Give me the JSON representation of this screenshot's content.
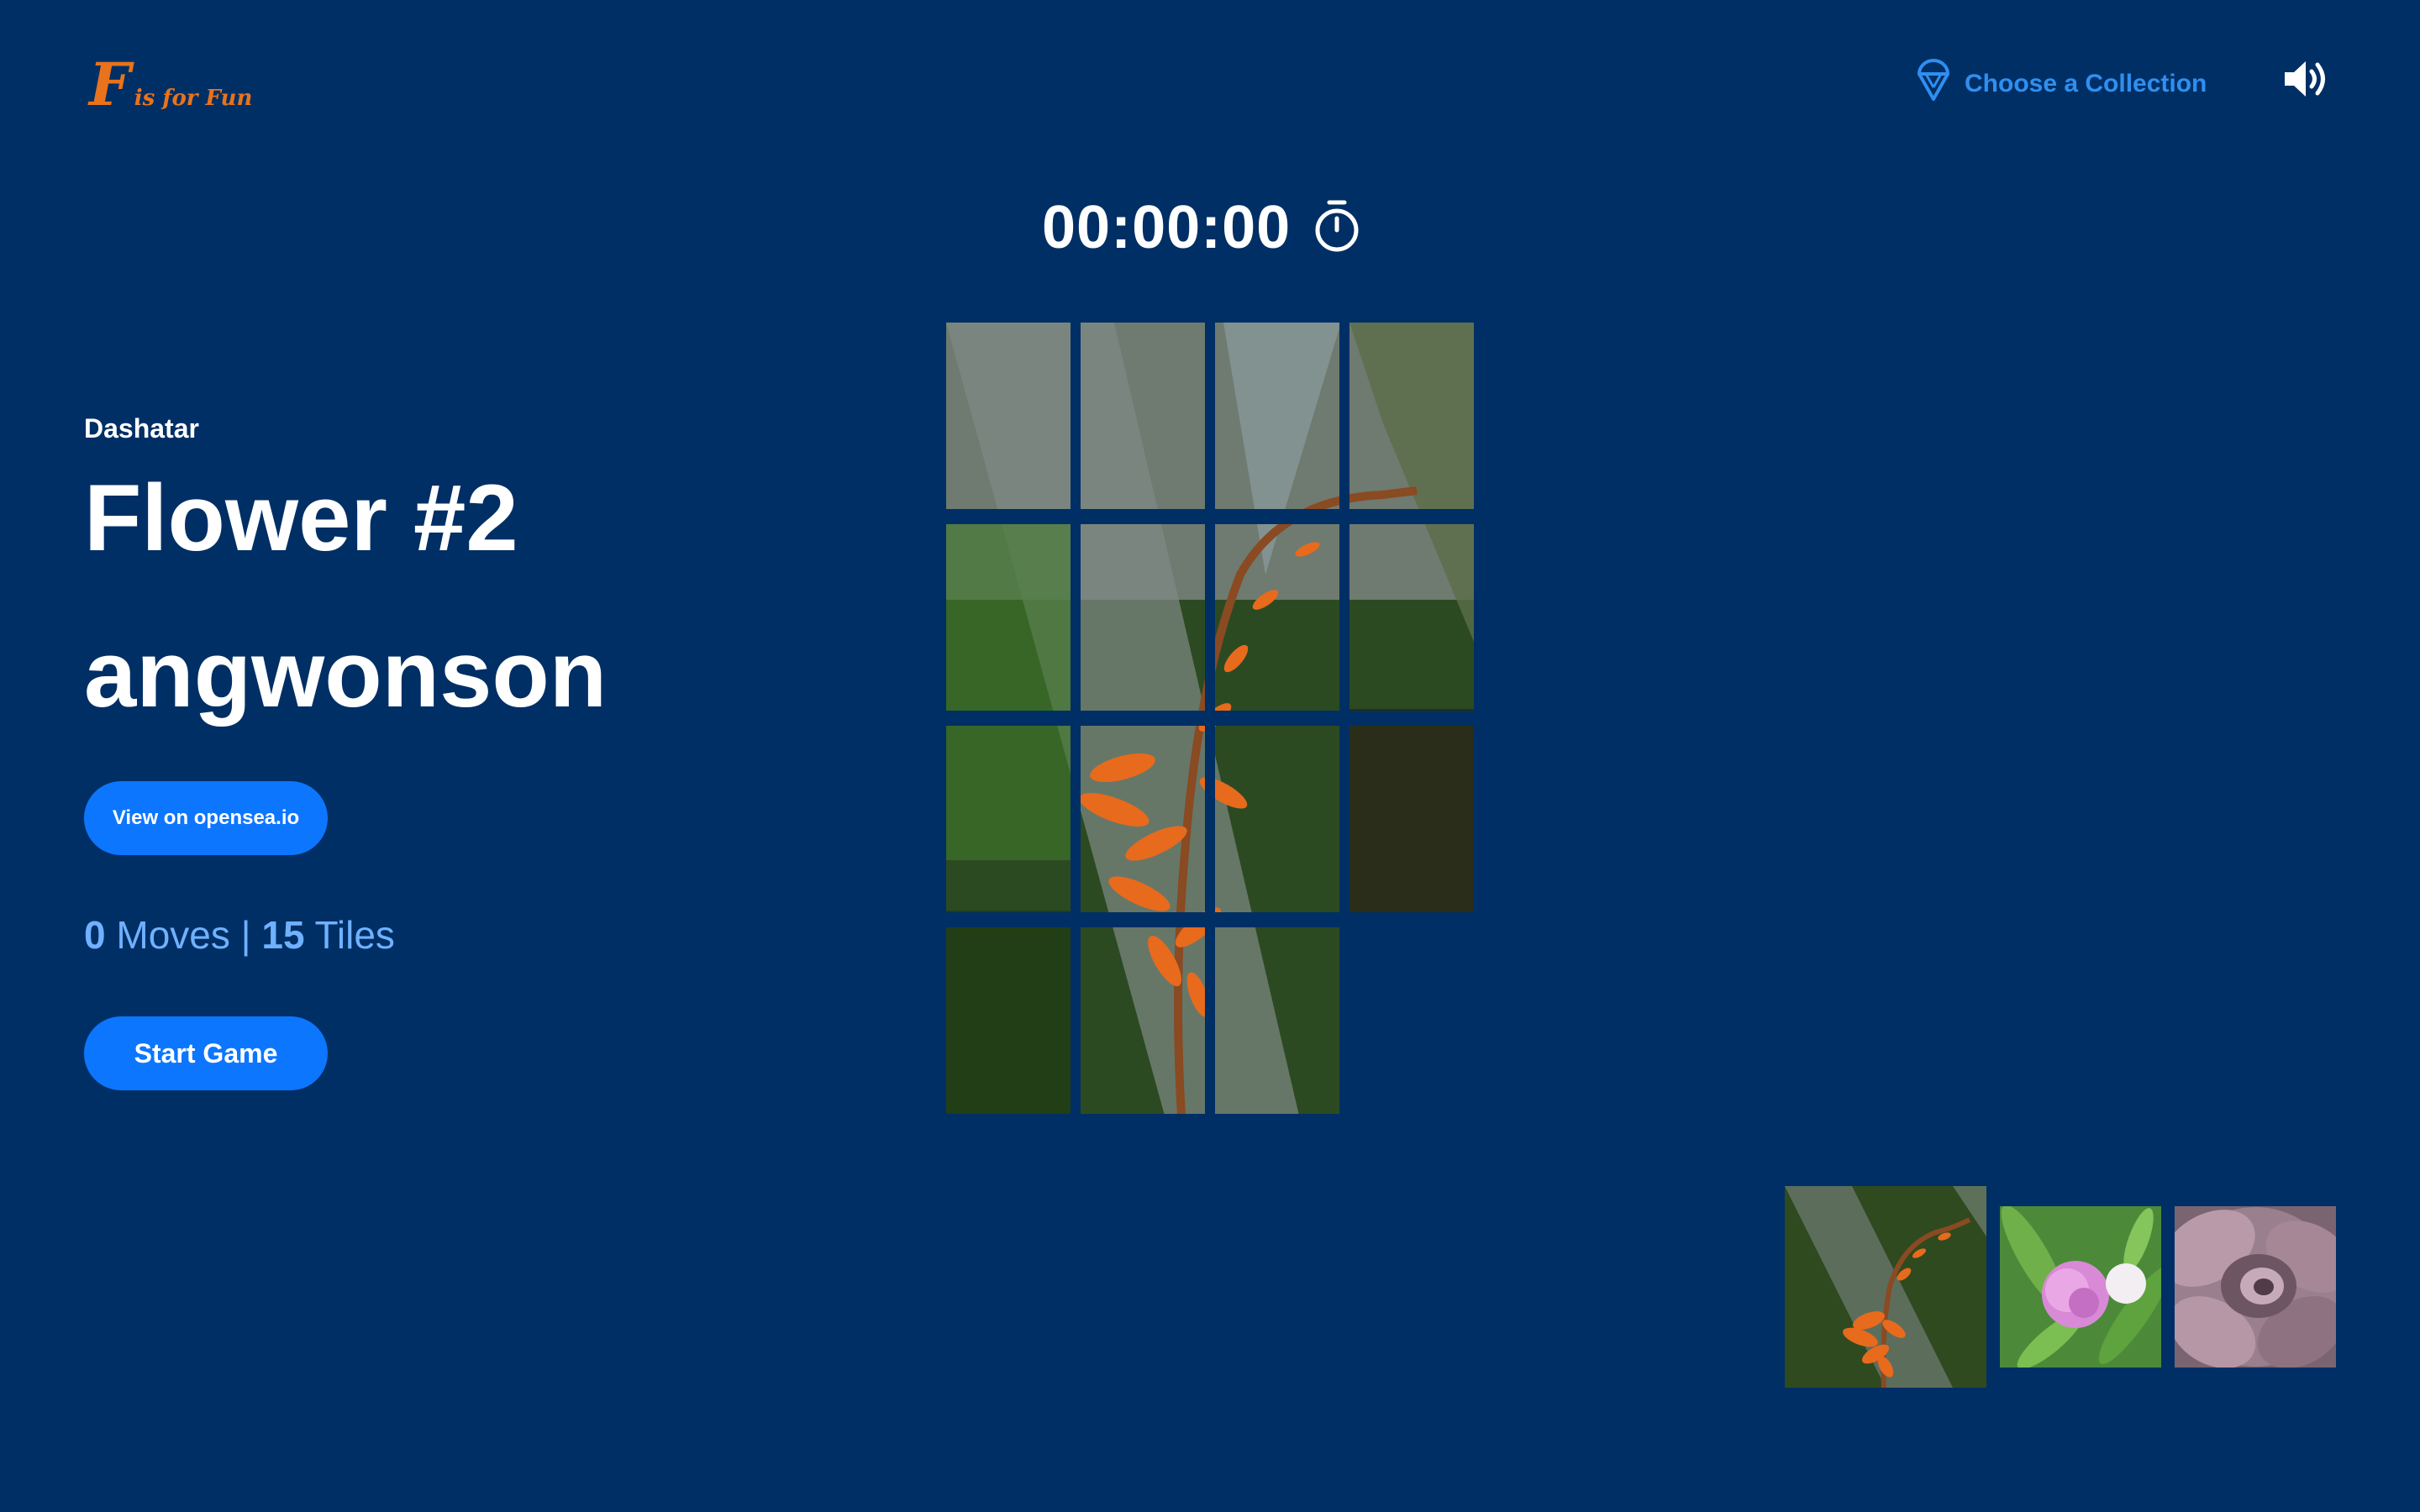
{
  "header": {
    "logo_letter": "F",
    "logo_text": "is for Fun",
    "collection_label": "Choose a Collection",
    "collection_icon": "ice-cream-icon",
    "sound_icon": "speaker-volume-icon"
  },
  "timer": {
    "value": "00:00:00",
    "icon": "stopwatch-icon"
  },
  "artwork": {
    "artist": "Dashatar",
    "title": "Flower #2",
    "owner": "angwonson"
  },
  "buttons": {
    "opensea_label": "View on opensea.io",
    "start_label": "Start Game"
  },
  "stats": {
    "moves": "0",
    "moves_label": "Moves",
    "separator": "|",
    "tiles": "15",
    "tiles_label": "Tiles"
  },
  "puzzle": {
    "grid": "4x4",
    "tile_count": 15,
    "empty_slot": 16
  },
  "thumbnails": [
    {
      "name": "orange-flower",
      "selected": true
    },
    {
      "name": "pink-flower",
      "selected": false
    },
    {
      "name": "succulent",
      "selected": false
    }
  ],
  "colors": {
    "background": "#002f65",
    "accent": "#0d76ff",
    "link": "#2f8ff0",
    "stats": "#6fb1ff",
    "logo": "#e8731c"
  }
}
